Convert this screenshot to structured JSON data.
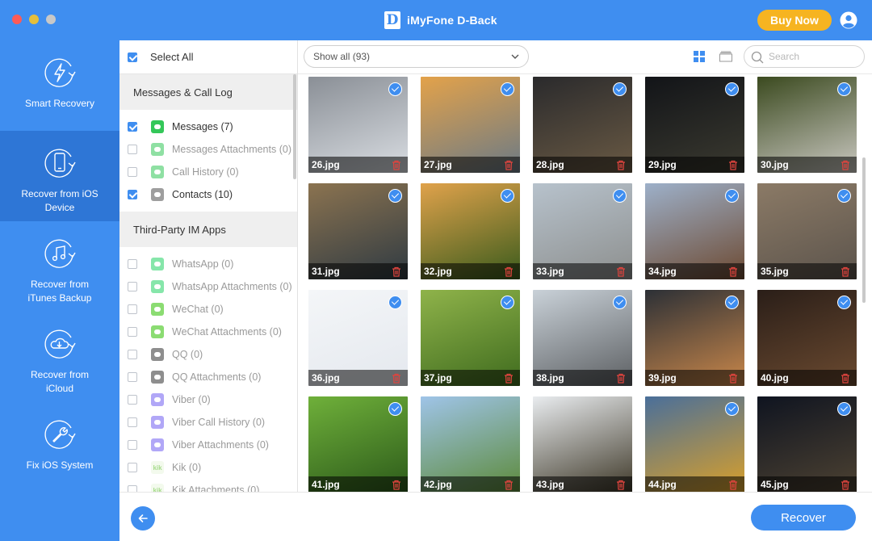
{
  "window": {
    "title": "iMyFone D-Back",
    "logo_letter": "D"
  },
  "header": {
    "buy_label": "Buy Now"
  },
  "sidebar": {
    "items": [
      {
        "label": "Smart Recovery",
        "active": false
      },
      {
        "label": "Recover from iOS Device",
        "active": true
      },
      {
        "label": "Recover from iTunes Backup",
        "active": false
      },
      {
        "label": "Recover from iCloud",
        "active": false
      },
      {
        "label": "Fix iOS System",
        "active": false
      }
    ]
  },
  "categories": {
    "select_all": {
      "label": "Select All",
      "checked": true
    },
    "sections": [
      {
        "title": "Messages & Call Log",
        "items": [
          {
            "label": "Messages (7)",
            "checked": true,
            "icon": "messages-icon",
            "color": "#34c759"
          },
          {
            "label": "Messages Attachments (0)",
            "checked": false,
            "icon": "messages-icon",
            "color": "#34c759"
          },
          {
            "label": "Call History (0)",
            "checked": false,
            "icon": "phone-icon",
            "color": "#34c759"
          },
          {
            "label": "Contacts (10)",
            "checked": true,
            "icon": "contacts-icon",
            "color": "#9e9e9e"
          }
        ]
      },
      {
        "title": "Third-Party IM Apps",
        "items": [
          {
            "label": "WhatsApp (0)",
            "checked": false,
            "icon": "whatsapp-icon",
            "color": "#25d366"
          },
          {
            "label": "WhatsApp Attachments (0)",
            "checked": false,
            "icon": "whatsapp-icon",
            "color": "#25d366"
          },
          {
            "label": "WeChat (0)",
            "checked": false,
            "icon": "wechat-icon",
            "color": "#2dc100"
          },
          {
            "label": "WeChat Attachments (0)",
            "checked": false,
            "icon": "wechat-icon",
            "color": "#2dc100"
          },
          {
            "label": "QQ (0)",
            "checked": false,
            "icon": "qq-icon",
            "color": "#333333"
          },
          {
            "label": "QQ Attachments (0)",
            "checked": false,
            "icon": "qq-icon",
            "color": "#333333"
          },
          {
            "label": "Viber (0)",
            "checked": false,
            "icon": "viber-icon",
            "color": "#7360f2"
          },
          {
            "label": "Viber Call History (0)",
            "checked": false,
            "icon": "viber-icon",
            "color": "#7360f2"
          },
          {
            "label": "Viber Attachments (0)",
            "checked": false,
            "icon": "viber-icon",
            "color": "#7360f2"
          },
          {
            "label": "Kik (0)",
            "checked": false,
            "icon": "kik-icon",
            "color": "#5fbf2d",
            "text": "kik"
          },
          {
            "label": "Kik Attachments (0)",
            "checked": false,
            "icon": "kik-icon",
            "color": "#5fbf2d",
            "text": "kik"
          }
        ]
      }
    ]
  },
  "toolbar": {
    "filter_value": "Show all (93)",
    "search_placeholder": "Search"
  },
  "gallery": {
    "photos": [
      {
        "name": "26.jpg",
        "checked": true,
        "c1": "#8a8f96",
        "c2": "#d9dde2"
      },
      {
        "name": "27.jpg",
        "checked": true,
        "c1": "#e3a24a",
        "c2": "#6b7a86"
      },
      {
        "name": "28.jpg",
        "checked": true,
        "c1": "#2a2a2c",
        "c2": "#6a5a44"
      },
      {
        "name": "29.jpg",
        "checked": true,
        "c1": "#121418",
        "c2": "#3b3a30"
      },
      {
        "name": "30.jpg",
        "checked": true,
        "c1": "#3b4a1f",
        "c2": "#c9c7c0"
      },
      {
        "name": "31.jpg",
        "checked": true,
        "c1": "#8b7350",
        "c2": "#2f3a42"
      },
      {
        "name": "32.jpg",
        "checked": true,
        "c1": "#e0a24b",
        "c2": "#3a5b1c"
      },
      {
        "name": "33.jpg",
        "checked": true,
        "c1": "#b7c2cc",
        "c2": "#8d8f8e"
      },
      {
        "name": "34.jpg",
        "checked": true,
        "c1": "#9db0c9",
        "c2": "#6d4a32"
      },
      {
        "name": "35.jpg",
        "checked": true,
        "c1": "#8b7a66",
        "c2": "#5c544c"
      },
      {
        "name": "36.jpg",
        "checked": true,
        "c1": "#f4f6f8",
        "c2": "#e4e8ee"
      },
      {
        "name": "37.jpg",
        "checked": true,
        "c1": "#8fb34a",
        "c2": "#3f6b1e"
      },
      {
        "name": "38.jpg",
        "checked": true,
        "c1": "#c9d1d8",
        "c2": "#5c5f62"
      },
      {
        "name": "39.jpg",
        "checked": true,
        "c1": "#2c3036",
        "c2": "#c9874a"
      },
      {
        "name": "40.jpg",
        "checked": true,
        "c1": "#2a1e18",
        "c2": "#6b4a30"
      },
      {
        "name": "41.jpg",
        "checked": true,
        "c1": "#6fb03a",
        "c2": "#2c5a1a"
      },
      {
        "name": "42.jpg",
        "checked": false,
        "c1": "#9fc4e8",
        "c2": "#5c8a3a"
      },
      {
        "name": "43.jpg",
        "checked": false,
        "c1": "#e9ecef",
        "c2": "#3e3828"
      },
      {
        "name": "44.jpg",
        "checked": true,
        "c1": "#4a6f9a",
        "c2": "#d9a02a"
      },
      {
        "name": "45.jpg",
        "checked": true,
        "c1": "#0f1420",
        "c2": "#4d4232"
      }
    ]
  },
  "footer": {
    "recover_label": "Recover"
  },
  "colors": {
    "accent": "#3f8ef0",
    "buy": "#f6b421",
    "delete": "#e0443e"
  }
}
